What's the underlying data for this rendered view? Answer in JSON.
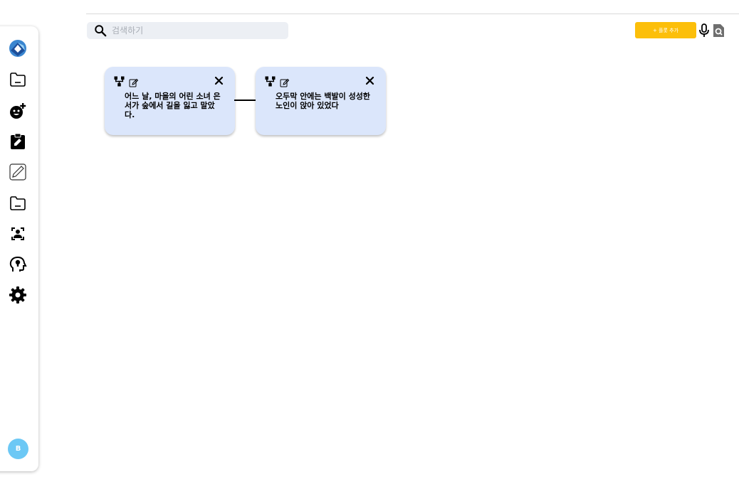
{
  "search": {
    "placeholder": "검색하기",
    "value": ""
  },
  "toolbar": {
    "add_flow_label": "+ 플롯 추가"
  },
  "sidebar": {
    "items": [
      {
        "icon": "logo-icon"
      },
      {
        "icon": "folder-icon"
      },
      {
        "icon": "face-add-icon"
      },
      {
        "icon": "assignment-edit-icon"
      },
      {
        "icon": "pencil-icon"
      },
      {
        "icon": "folder-icon"
      },
      {
        "icon": "person-focus-icon"
      },
      {
        "icon": "psychology-icon"
      },
      {
        "icon": "settings-icon"
      }
    ],
    "avatar_initial": "B"
  },
  "cards": [
    {
      "text": "어느 날, 마을의 어린 소녀 은서가 숲에서 길을 잃고 말았다."
    },
    {
      "text": "오두막 안에는 백발이 성성한 노인이 앉아 있었다"
    }
  ],
  "colors": {
    "accent": "#fcbf0a",
    "card_bg": "#dbe6fb",
    "avatar": "#6cc8f5",
    "logo_blue": "#2f6fbf"
  }
}
